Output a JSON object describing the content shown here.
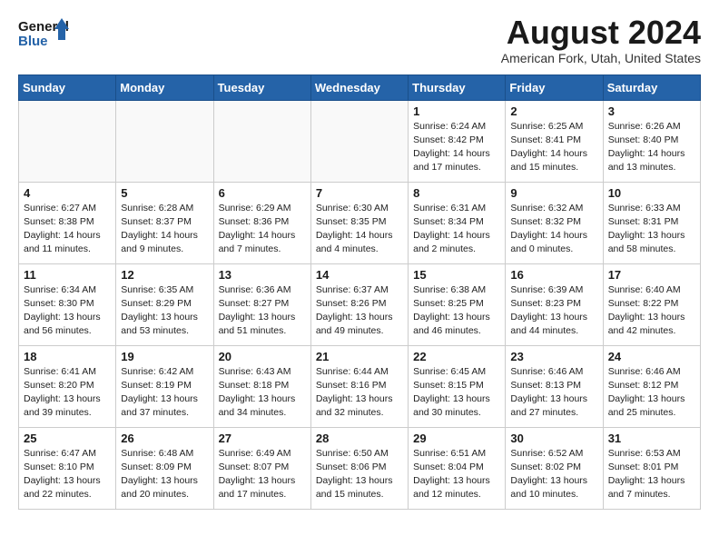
{
  "header": {
    "logo_general": "General",
    "logo_blue": "Blue",
    "month_year": "August 2024",
    "location": "American Fork, Utah, United States"
  },
  "days_of_week": [
    "Sunday",
    "Monday",
    "Tuesday",
    "Wednesday",
    "Thursday",
    "Friday",
    "Saturday"
  ],
  "weeks": [
    [
      {
        "day": "",
        "info": ""
      },
      {
        "day": "",
        "info": ""
      },
      {
        "day": "",
        "info": ""
      },
      {
        "day": "",
        "info": ""
      },
      {
        "day": "1",
        "info": "Sunrise: 6:24 AM\nSunset: 8:42 PM\nDaylight: 14 hours\nand 17 minutes."
      },
      {
        "day": "2",
        "info": "Sunrise: 6:25 AM\nSunset: 8:41 PM\nDaylight: 14 hours\nand 15 minutes."
      },
      {
        "day": "3",
        "info": "Sunrise: 6:26 AM\nSunset: 8:40 PM\nDaylight: 14 hours\nand 13 minutes."
      }
    ],
    [
      {
        "day": "4",
        "info": "Sunrise: 6:27 AM\nSunset: 8:38 PM\nDaylight: 14 hours\nand 11 minutes."
      },
      {
        "day": "5",
        "info": "Sunrise: 6:28 AM\nSunset: 8:37 PM\nDaylight: 14 hours\nand 9 minutes."
      },
      {
        "day": "6",
        "info": "Sunrise: 6:29 AM\nSunset: 8:36 PM\nDaylight: 14 hours\nand 7 minutes."
      },
      {
        "day": "7",
        "info": "Sunrise: 6:30 AM\nSunset: 8:35 PM\nDaylight: 14 hours\nand 4 minutes."
      },
      {
        "day": "8",
        "info": "Sunrise: 6:31 AM\nSunset: 8:34 PM\nDaylight: 14 hours\nand 2 minutes."
      },
      {
        "day": "9",
        "info": "Sunrise: 6:32 AM\nSunset: 8:32 PM\nDaylight: 14 hours\nand 0 minutes."
      },
      {
        "day": "10",
        "info": "Sunrise: 6:33 AM\nSunset: 8:31 PM\nDaylight: 13 hours\nand 58 minutes."
      }
    ],
    [
      {
        "day": "11",
        "info": "Sunrise: 6:34 AM\nSunset: 8:30 PM\nDaylight: 13 hours\nand 56 minutes."
      },
      {
        "day": "12",
        "info": "Sunrise: 6:35 AM\nSunset: 8:29 PM\nDaylight: 13 hours\nand 53 minutes."
      },
      {
        "day": "13",
        "info": "Sunrise: 6:36 AM\nSunset: 8:27 PM\nDaylight: 13 hours\nand 51 minutes."
      },
      {
        "day": "14",
        "info": "Sunrise: 6:37 AM\nSunset: 8:26 PM\nDaylight: 13 hours\nand 49 minutes."
      },
      {
        "day": "15",
        "info": "Sunrise: 6:38 AM\nSunset: 8:25 PM\nDaylight: 13 hours\nand 46 minutes."
      },
      {
        "day": "16",
        "info": "Sunrise: 6:39 AM\nSunset: 8:23 PM\nDaylight: 13 hours\nand 44 minutes."
      },
      {
        "day": "17",
        "info": "Sunrise: 6:40 AM\nSunset: 8:22 PM\nDaylight: 13 hours\nand 42 minutes."
      }
    ],
    [
      {
        "day": "18",
        "info": "Sunrise: 6:41 AM\nSunset: 8:20 PM\nDaylight: 13 hours\nand 39 minutes."
      },
      {
        "day": "19",
        "info": "Sunrise: 6:42 AM\nSunset: 8:19 PM\nDaylight: 13 hours\nand 37 minutes."
      },
      {
        "day": "20",
        "info": "Sunrise: 6:43 AM\nSunset: 8:18 PM\nDaylight: 13 hours\nand 34 minutes."
      },
      {
        "day": "21",
        "info": "Sunrise: 6:44 AM\nSunset: 8:16 PM\nDaylight: 13 hours\nand 32 minutes."
      },
      {
        "day": "22",
        "info": "Sunrise: 6:45 AM\nSunset: 8:15 PM\nDaylight: 13 hours\nand 30 minutes."
      },
      {
        "day": "23",
        "info": "Sunrise: 6:46 AM\nSunset: 8:13 PM\nDaylight: 13 hours\nand 27 minutes."
      },
      {
        "day": "24",
        "info": "Sunrise: 6:46 AM\nSunset: 8:12 PM\nDaylight: 13 hours\nand 25 minutes."
      }
    ],
    [
      {
        "day": "25",
        "info": "Sunrise: 6:47 AM\nSunset: 8:10 PM\nDaylight: 13 hours\nand 22 minutes."
      },
      {
        "day": "26",
        "info": "Sunrise: 6:48 AM\nSunset: 8:09 PM\nDaylight: 13 hours\nand 20 minutes."
      },
      {
        "day": "27",
        "info": "Sunrise: 6:49 AM\nSunset: 8:07 PM\nDaylight: 13 hours\nand 17 minutes."
      },
      {
        "day": "28",
        "info": "Sunrise: 6:50 AM\nSunset: 8:06 PM\nDaylight: 13 hours\nand 15 minutes."
      },
      {
        "day": "29",
        "info": "Sunrise: 6:51 AM\nSunset: 8:04 PM\nDaylight: 13 hours\nand 12 minutes."
      },
      {
        "day": "30",
        "info": "Sunrise: 6:52 AM\nSunset: 8:02 PM\nDaylight: 13 hours\nand 10 minutes."
      },
      {
        "day": "31",
        "info": "Sunrise: 6:53 AM\nSunset: 8:01 PM\nDaylight: 13 hours\nand 7 minutes."
      }
    ]
  ]
}
